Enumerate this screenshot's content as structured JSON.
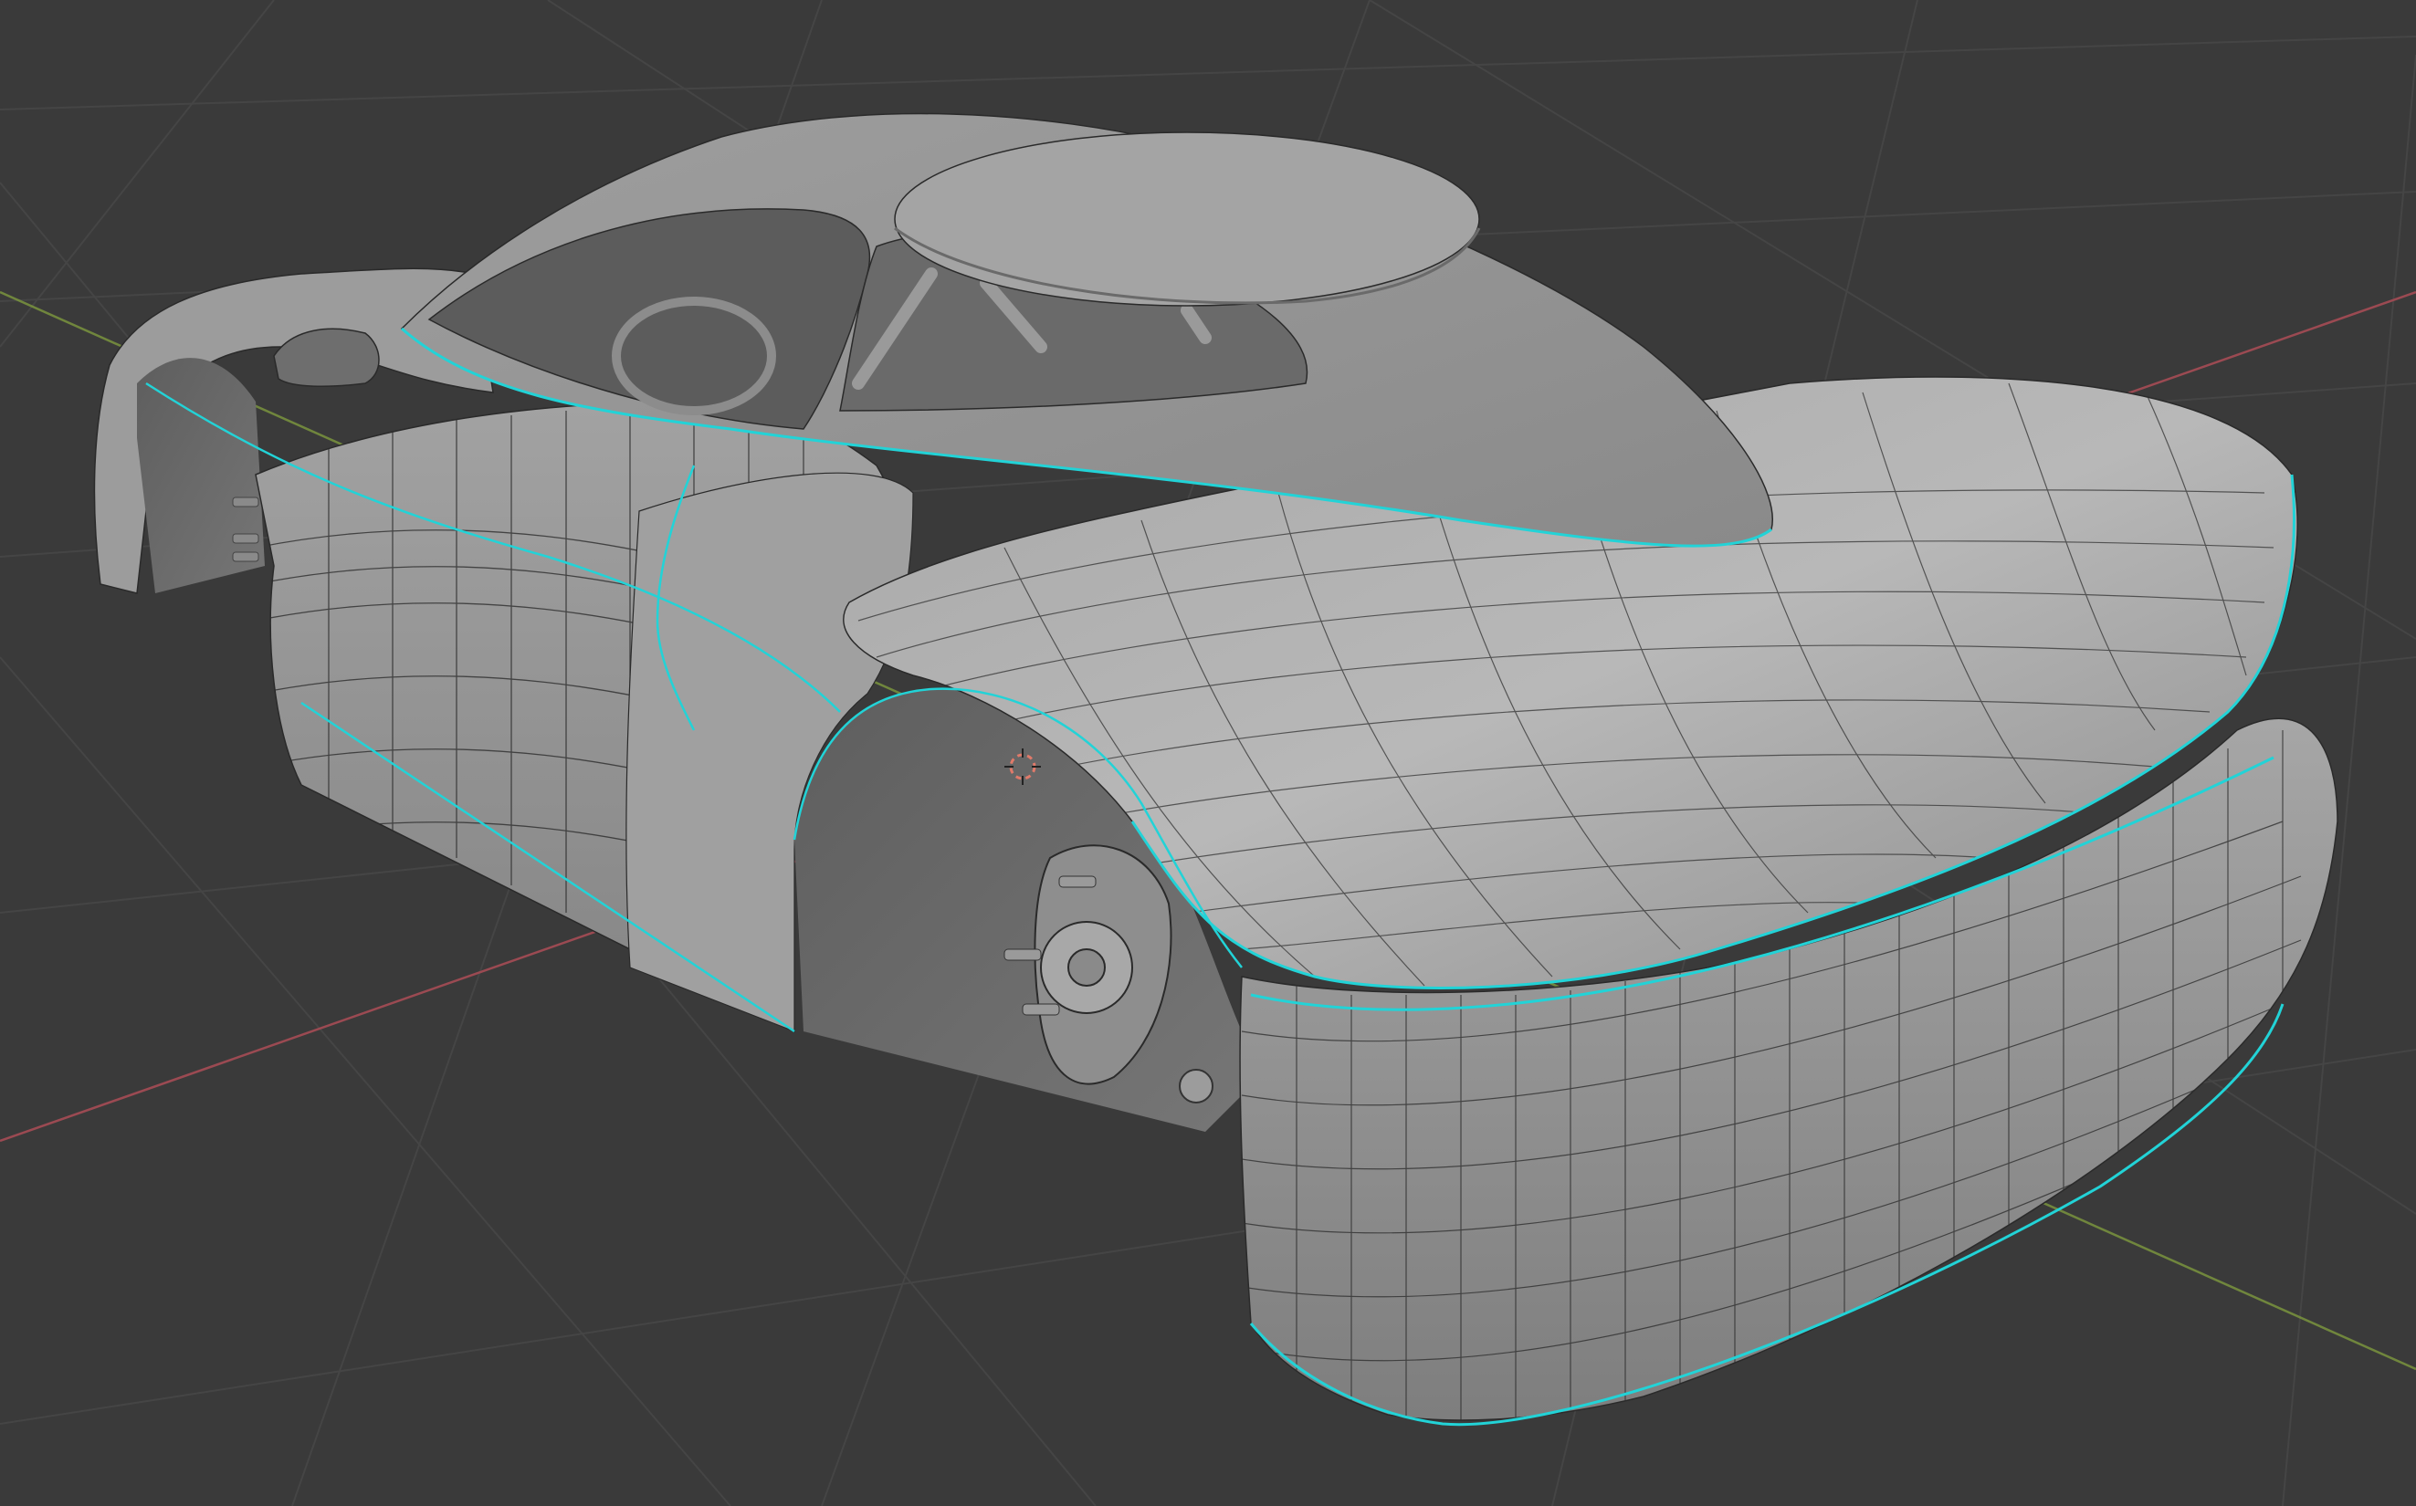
{
  "viewport": {
    "view": "3d-viewport",
    "mode": "edit-mode-wireframe-overlay",
    "shading": "solid",
    "colors": {
      "background": "#3a3a3a",
      "grid": "#4a4a4a",
      "x_axis": "#9b4a52",
      "y_axis": "#7e9a3e",
      "mesh_light": "#b4b4b4",
      "mesh_mid": "#9a9a9a",
      "mesh_dark": "#6c6c6c",
      "wire": "#2a2a2a",
      "seam_edge": "#22d3d7",
      "cursor_3d": "#e07a6a"
    }
  },
  "object": {
    "icon": "car-body-mesh",
    "parts": [
      "cabin-dome",
      "roof",
      "interior-roll-cage",
      "side-mirror",
      "rear-deck",
      "rear-bumper",
      "front-wheel-arch",
      "rear-wheel-arch",
      "rear-brake-hub"
    ]
  },
  "cursor": {
    "icon": "3d-cursor-icon"
  }
}
